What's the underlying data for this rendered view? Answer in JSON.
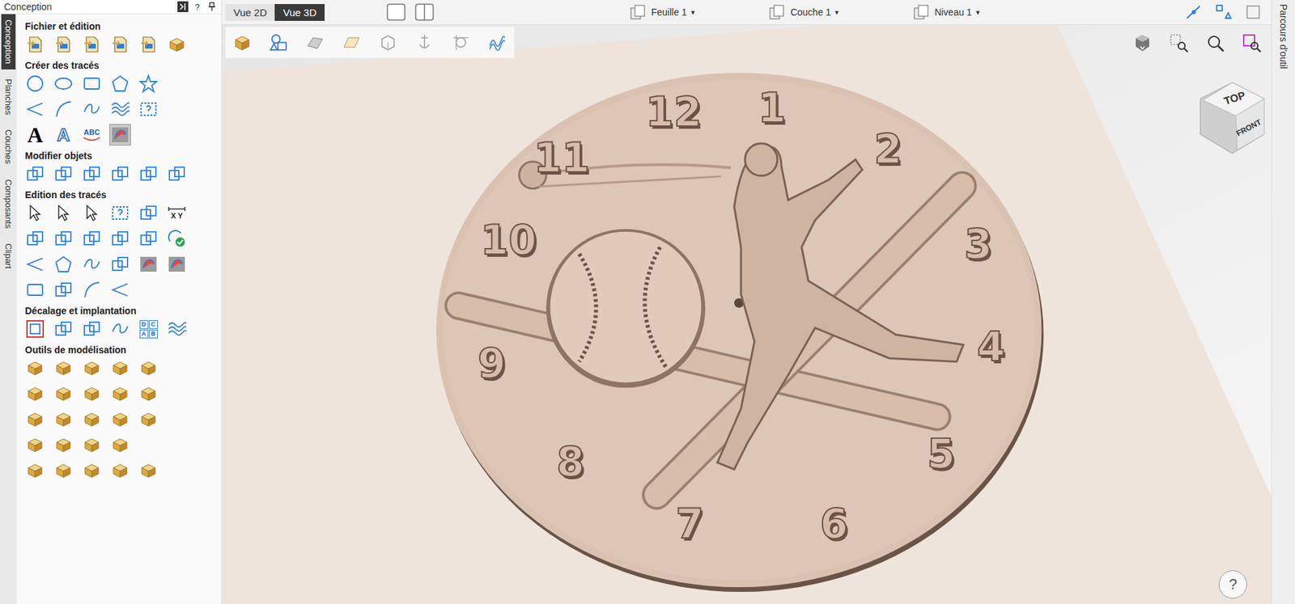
{
  "panel": {
    "title": "Conception",
    "help": "?"
  },
  "side_tabs": [
    {
      "label": "Conception",
      "selected": true
    },
    {
      "label": "Planches",
      "selected": false
    },
    {
      "label": "Couches",
      "selected": false
    },
    {
      "label": "Composants",
      "selected": false
    },
    {
      "label": "Clipart",
      "selected": false
    }
  ],
  "sections": [
    {
      "title": "Fichier et édition",
      "rows": [
        [
          {
            "kind": "doc",
            "selected": false
          },
          {
            "kind": "doc",
            "selected": false
          },
          {
            "kind": "doc",
            "selected": false
          },
          {
            "kind": "doc",
            "selected": false
          },
          {
            "kind": "doc",
            "selected": false
          },
          {
            "kind": "gold",
            "selected": false
          }
        ]
      ]
    },
    {
      "title": "Créer des tracés",
      "rows": [
        [
          {
            "kind": "circle",
            "selected": false
          },
          {
            "kind": "ellipse",
            "selected": false
          },
          {
            "kind": "rect",
            "selected": false
          },
          {
            "kind": "polygon",
            "selected": false
          },
          {
            "kind": "star",
            "selected": false
          }
        ],
        [
          {
            "kind": "line",
            "selected": false
          },
          {
            "kind": "arc",
            "selected": false
          },
          {
            "kind": "curve",
            "selected": false
          },
          {
            "kind": "wave",
            "selected": false
          },
          {
            "kind": "dashed",
            "selected": false
          }
        ],
        [
          {
            "kind": "text",
            "label": "A",
            "selected": false
          },
          {
            "kind": "text-outline",
            "label": "A",
            "selected": false
          },
          {
            "kind": "text-arc",
            "label": "ABC",
            "selected": false
          },
          {
            "kind": "picture",
            "selected": true
          }
        ]
      ]
    },
    {
      "title": "Modifier objets",
      "rows": [
        [
          {
            "kind": "blue",
            "selected": false
          },
          {
            "kind": "blue",
            "selected": false
          },
          {
            "kind": "blue",
            "selected": false
          },
          {
            "kind": "blue",
            "selected": false
          },
          {
            "kind": "blue",
            "selected": false
          },
          {
            "kind": "blue",
            "selected": false
          }
        ]
      ]
    },
    {
      "title": "Edition des tracés",
      "rows": [
        [
          {
            "kind": "cursor",
            "selected": false
          },
          {
            "kind": "cursor",
            "selected": false
          },
          {
            "kind": "cursor",
            "selected": false
          },
          {
            "kind": "dashed",
            "selected": false
          },
          {
            "kind": "blue",
            "selected": false
          },
          {
            "kind": "measure",
            "label": "X Y",
            "selected": false
          }
        ],
        [
          {
            "kind": "blue",
            "selected": false
          },
          {
            "kind": "blue",
            "selected": false
          },
          {
            "kind": "blue",
            "selected": false
          },
          {
            "kind": "blue",
            "selected": false
          },
          {
            "kind": "blue",
            "selected": false
          },
          {
            "kind": "check",
            "selected": false
          }
        ],
        [
          {
            "kind": "line",
            "selected": false
          },
          {
            "kind": "polygon",
            "selected": false
          },
          {
            "kind": "curve",
            "selected": false
          },
          {
            "kind": "blue",
            "selected": false
          },
          {
            "kind": "picture",
            "selected": false
          },
          {
            "kind": "picture",
            "selected": false
          }
        ],
        [
          {
            "kind": "rect",
            "selected": false
          },
          {
            "kind": "blue",
            "selected": false
          },
          {
            "kind": "arc",
            "selected": false
          },
          {
            "kind": "line",
            "selected": false
          }
        ]
      ]
    },
    {
      "title": "Décalage et implantation",
      "rows": [
        [
          {
            "kind": "offset",
            "selected": false
          },
          {
            "kind": "blue",
            "selected": false
          },
          {
            "kind": "blue",
            "selected": false
          },
          {
            "kind": "curve",
            "selected": false
          },
          {
            "kind": "grid-text",
            "labels": [
              "D",
              "C",
              "A",
              "B"
            ],
            "selected": false
          },
          {
            "kind": "wave",
            "selected": false
          }
        ]
      ]
    },
    {
      "title": "Outils de modélisation",
      "rows": [
        [
          {
            "kind": "gold",
            "selected": false
          },
          {
            "kind": "gold",
            "selected": false
          },
          {
            "kind": "gold",
            "selected": false
          },
          {
            "kind": "gold",
            "selected": false
          },
          {
            "kind": "gold",
            "selected": false
          }
        ],
        [
          {
            "kind": "gold",
            "selected": false
          },
          {
            "kind": "gold",
            "selected": false
          },
          {
            "kind": "gold",
            "selected": false
          },
          {
            "kind": "gold",
            "selected": false
          },
          {
            "kind": "gold",
            "selected": false
          }
        ],
        [
          {
            "kind": "gold",
            "selected": false
          },
          {
            "kind": "gold",
            "selected": false
          },
          {
            "kind": "gold",
            "selected": false
          },
          {
            "kind": "gold",
            "selected": false
          },
          {
            "kind": "gold",
            "selected": false
          }
        ],
        [
          {
            "kind": "gold",
            "selected": false
          },
          {
            "kind": "gold",
            "selected": false
          },
          {
            "kind": "gold",
            "selected": false
          },
          {
            "kind": "gold",
            "selected": false
          }
        ],
        [
          {
            "kind": "gold",
            "selected": false
          },
          {
            "kind": "gold",
            "selected": false
          },
          {
            "kind": "gold",
            "selected": false
          },
          {
            "kind": "gold",
            "selected": false
          },
          {
            "kind": "gold",
            "selected": false
          }
        ]
      ]
    }
  ],
  "view_tabs": [
    {
      "label": "Vue 2D",
      "selected": false
    },
    {
      "label": "Vue 3D",
      "selected": true
    }
  ],
  "dropdowns": [
    {
      "label": "Feuille 1",
      "arrow": "▾"
    },
    {
      "label": "Couche 1",
      "arrow": "▾"
    },
    {
      "label": "Niveau 1",
      "arrow": "▾"
    }
  ],
  "right_tab": {
    "label": "Parcours d'outil"
  },
  "view_cube": {
    "top": "TOP",
    "front": "FRONT"
  },
  "help": "?",
  "clock": {
    "numerals": [
      "12",
      "1",
      "2",
      "3",
      "4",
      "5",
      "6",
      "7",
      "8",
      "9",
      "10",
      "11"
    ]
  }
}
